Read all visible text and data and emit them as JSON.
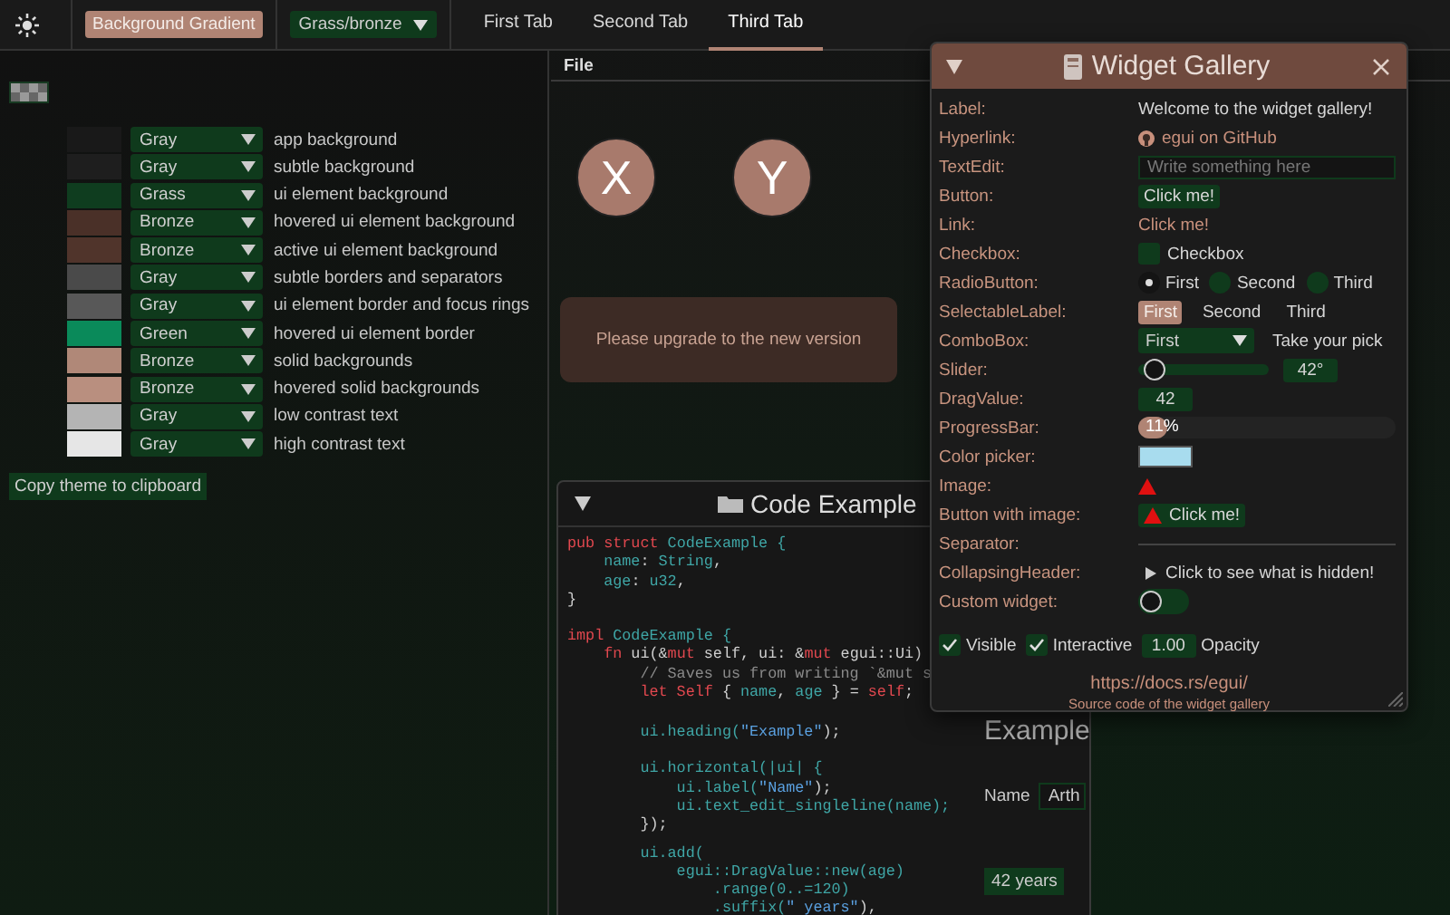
{
  "toolbar": {
    "gradient_button": "Background Gradient",
    "theme_combo": "Grass/bronze"
  },
  "tabs": [
    {
      "label": "First Tab",
      "selected": false
    },
    {
      "label": "Second Tab",
      "selected": false
    },
    {
      "label": "Third Tab",
      "selected": true
    }
  ],
  "theme_panel": {
    "rows": [
      {
        "color": "#191919",
        "scale": "Gray",
        "role": "app background"
      },
      {
        "color": "#1e1e1e",
        "scale": "Gray",
        "role": "subtle background"
      },
      {
        "color": "#0f3d1f",
        "scale": "Grass",
        "role": "ui element background"
      },
      {
        "color": "#4a3028",
        "scale": "Bronze",
        "role": "hovered ui element background"
      },
      {
        "color": "#50342b",
        "scale": "Bronze",
        "role": "active ui element background"
      },
      {
        "color": "#4a4a4a",
        "scale": "Gray",
        "role": "subtle borders and separators"
      },
      {
        "color": "#585858",
        "scale": "Gray",
        "role": "ui element border and focus rings"
      },
      {
        "color": "#0a8a5a",
        "scale": "Green",
        "role": "hovered ui element border"
      },
      {
        "color": "#b08878",
        "scale": "Bronze",
        "role": "solid backgrounds"
      },
      {
        "color": "#b98f7f",
        "scale": "Bronze",
        "role": "hovered solid backgrounds"
      },
      {
        "color": "#b4b4b4",
        "scale": "Gray",
        "role": "low contrast text"
      },
      {
        "color": "#e6e6e6",
        "scale": "Gray",
        "role": "high contrast text"
      }
    ],
    "copy_button": "Copy theme to clipboard"
  },
  "central_panel": {
    "menu": [
      "File"
    ],
    "round_buttons": [
      "X",
      "Y"
    ],
    "notice": "Please upgrade to the new version"
  },
  "code_window": {
    "title": "Code Example",
    "blocks": [
      {
        "lines": [
          [
            {
              "text": "pub struct",
              "kind": "keyword"
            },
            {
              "text": " CodeExample {",
              "kind": "type"
            }
          ],
          [
            {
              "text": "    name",
              "kind": "type"
            },
            {
              "text": ": ",
              "kind": "plain"
            },
            {
              "text": "String",
              "kind": "type"
            },
            {
              "text": ",",
              "kind": "plain"
            }
          ],
          [
            {
              "text": "    age",
              "kind": "type"
            },
            {
              "text": ": ",
              "kind": "plain"
            },
            {
              "text": "u32",
              "kind": "type"
            },
            {
              "text": ",",
              "kind": "plain"
            }
          ],
          [
            {
              "text": "}",
              "kind": "plain"
            }
          ]
        ]
      },
      {
        "lines": [
          [
            {
              "text": "impl",
              "kind": "keyword"
            },
            {
              "text": " CodeExample {",
              "kind": "type"
            }
          ],
          [
            {
              "text": "    fn",
              "kind": "keyword"
            },
            {
              "text": " ui(&",
              "kind": "plain"
            },
            {
              "text": "mut",
              "kind": "keyword"
            },
            {
              "text": " self, ui: &",
              "kind": "plain"
            },
            {
              "text": "mut",
              "kind": "keyword"
            },
            {
              "text": " egui::Ui)",
              "kind": "plain"
            }
          ],
          [
            {
              "text": "        // Saves us from writing `&mut s",
              "kind": "comment"
            }
          ],
          [
            {
              "text": "        let Self",
              "kind": "keyword"
            },
            {
              "text": " { ",
              "kind": "plain"
            },
            {
              "text": "name",
              "kind": "type"
            },
            {
              "text": ", ",
              "kind": "plain"
            },
            {
              "text": "age",
              "kind": "type"
            },
            {
              "text": " } = ",
              "kind": "plain"
            },
            {
              "text": "self",
              "kind": "keyword"
            },
            {
              "text": ";",
              "kind": "plain"
            }
          ]
        ]
      },
      {
        "lines": [
          [
            {
              "text": "        ui.heading(",
              "kind": "type"
            },
            {
              "text": "\"Example\"",
              "kind": "string"
            },
            {
              "text": ");",
              "kind": "plain"
            }
          ]
        ],
        "preview": {
          "kind": "heading",
          "text": "Example"
        }
      },
      {
        "lines": [
          [
            {
              "text": "        ui.horizontal(|ui| {",
              "kind": "type"
            }
          ],
          [
            {
              "text": "            ui.label(",
              "kind": "type"
            },
            {
              "text": "\"Name\"",
              "kind": "string"
            },
            {
              "text": ");",
              "kind": "plain"
            }
          ],
          [
            {
              "text": "            ui.text_edit_singleline(name);",
              "kind": "type"
            }
          ],
          [
            {
              "text": "        });",
              "kind": "plain"
            }
          ]
        ],
        "preview": {
          "kind": "labeled_field",
          "label": "Name",
          "value": "Arth"
        }
      },
      {
        "lines": [
          [
            {
              "text": "        ui.add(",
              "kind": "type"
            }
          ],
          [
            {
              "text": "            egui::DragValue::new(age)",
              "kind": "type"
            }
          ],
          [
            {
              "text": "                .range(0..=120)",
              "kind": "type"
            }
          ],
          [
            {
              "text": "                .suffix(",
              "kind": "type"
            },
            {
              "text": "\" years\"",
              "kind": "string"
            },
            {
              "text": "),",
              "kind": "plain"
            }
          ]
        ],
        "preview": {
          "kind": "drag",
          "value": "42 years"
        }
      }
    ]
  },
  "widget_gallery": {
    "title": "Widget Gallery",
    "rows": [
      {
        "label": "Label:",
        "kind": "label",
        "text": "Welcome to the widget gallery!"
      },
      {
        "label": "Hyperlink:",
        "kind": "hyperlink",
        "text": "egui on GitHub"
      },
      {
        "label": "TextEdit:",
        "kind": "textedit",
        "placeholder": "Write something here"
      },
      {
        "label": "Button:",
        "kind": "button",
        "text": "Click me!"
      },
      {
        "label": "Link:",
        "kind": "link",
        "text": "Click me!"
      },
      {
        "label": "Checkbox:",
        "kind": "checkbox",
        "text": "Checkbox",
        "checked": false
      },
      {
        "label": "RadioButton:",
        "kind": "radio",
        "options": [
          {
            "label": "First",
            "selected": true
          },
          {
            "label": "Second",
            "selected": false
          },
          {
            "label": "Third",
            "selected": false
          }
        ]
      },
      {
        "label": "SelectableLabel:",
        "kind": "selectable",
        "options": [
          {
            "label": "First",
            "selected": true
          },
          {
            "label": "Second",
            "selected": false
          },
          {
            "label": "Third",
            "selected": false
          }
        ]
      },
      {
        "label": "ComboBox:",
        "kind": "combo",
        "value": "First",
        "text": "Take your pick"
      },
      {
        "label": "Slider:",
        "kind": "slider",
        "level": 0.12,
        "value": "42°"
      },
      {
        "label": "DragValue:",
        "kind": "drag",
        "value": "42"
      },
      {
        "label": "ProgressBar:",
        "kind": "progress",
        "level": 0.11,
        "value": "11%"
      },
      {
        "label": "Color picker:",
        "kind": "color",
        "color": "#a8dcee"
      },
      {
        "label": "Image:",
        "kind": "image"
      },
      {
        "label": "Button with image:",
        "kind": "image_button",
        "text": "Click me!"
      },
      {
        "label": "Separator:",
        "kind": "separator"
      },
      {
        "label": "CollapsingHeader:",
        "kind": "collapsing",
        "text": "Click to see what is hidden!",
        "expanded": false
      },
      {
        "label": "Custom widget:",
        "kind": "toggle",
        "on": false
      }
    ],
    "footer": {
      "checks": [
        {
          "label": "Visible",
          "checked": true
        },
        {
          "label": "Interactive",
          "checked": true
        }
      ],
      "opacity_value": "1.00",
      "opacity_label": "Opacity"
    },
    "link": "https://docs.rs/egui/",
    "caption": "Source code of the widget gallery"
  }
}
